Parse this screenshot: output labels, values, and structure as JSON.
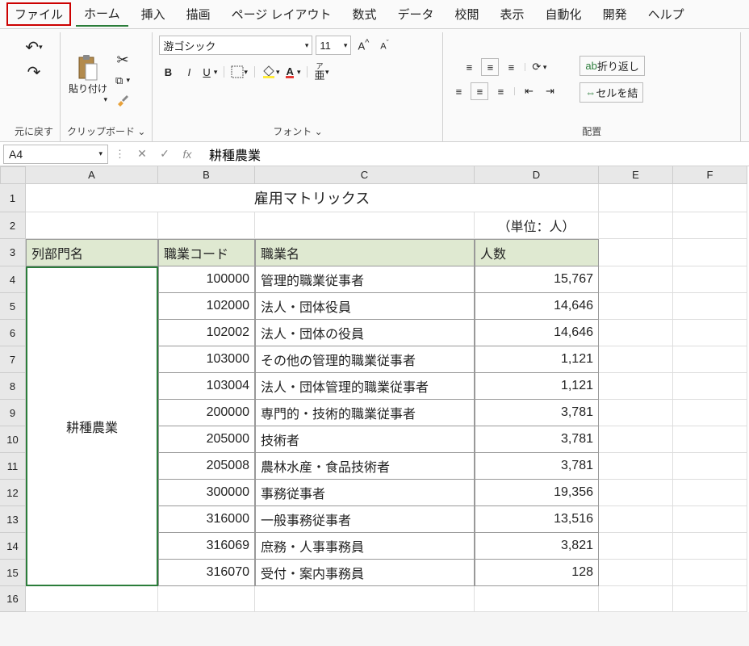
{
  "menu": {
    "file": "ファイル",
    "home": "ホーム",
    "insert": "挿入",
    "draw": "描画",
    "layout": "ページ レイアウト",
    "formulas": "数式",
    "data": "データ",
    "review": "校閲",
    "view": "表示",
    "automate": "自動化",
    "developer": "開発",
    "help": "ヘルプ"
  },
  "ribbon": {
    "undo_group": "元に戻す",
    "clipboard_group": "クリップボード",
    "paste": "貼り付け",
    "font_group": "フォント",
    "font_name": "游ゴシック",
    "font_size": "11",
    "bold": "B",
    "italic": "I",
    "underline": "U",
    "ruby": "ア\n亜",
    "align_group": "配置",
    "wrap": "折り返し",
    "merge": "セルを結"
  },
  "formula_bar": {
    "cell_ref": "A4",
    "fx": "fx",
    "value": "耕種農業"
  },
  "sheet": {
    "cols": [
      "A",
      "B",
      "C",
      "D",
      "E",
      "F"
    ],
    "title": "雇用マトリックス",
    "unit": "（単位：人）",
    "headers": {
      "a": "列部門名",
      "b": "職業コード",
      "c": "職業名",
      "d": "人数"
    },
    "mergedA": "耕種農業",
    "rows": [
      {
        "b": "100000",
        "c": "管理的職業従事者",
        "d": "15,767"
      },
      {
        "b": "102000",
        "c": "法人・団体役員",
        "d": "14,646"
      },
      {
        "b": "102002",
        "c": "法人・団体の役員",
        "d": "14,646"
      },
      {
        "b": "103000",
        "c": "その他の管理的職業従事者",
        "d": "1,121"
      },
      {
        "b": "103004",
        "c": "法人・団体管理的職業従事者",
        "d": "1,121"
      },
      {
        "b": "200000",
        "c": "専門的・技術的職業従事者",
        "d": "3,781"
      },
      {
        "b": "205000",
        "c": "技術者",
        "d": "3,781"
      },
      {
        "b": "205008",
        "c": "農林水産・食品技術者",
        "d": "3,781"
      },
      {
        "b": "300000",
        "c": "事務従事者",
        "d": "19,356"
      },
      {
        "b": "316000",
        "c": "一般事務従事者",
        "d": "13,516"
      },
      {
        "b": "316069",
        "c": "庶務・人事事務員",
        "d": "3,821"
      },
      {
        "b": "316070",
        "c": "受付・案内事務員",
        "d": "128"
      }
    ]
  }
}
